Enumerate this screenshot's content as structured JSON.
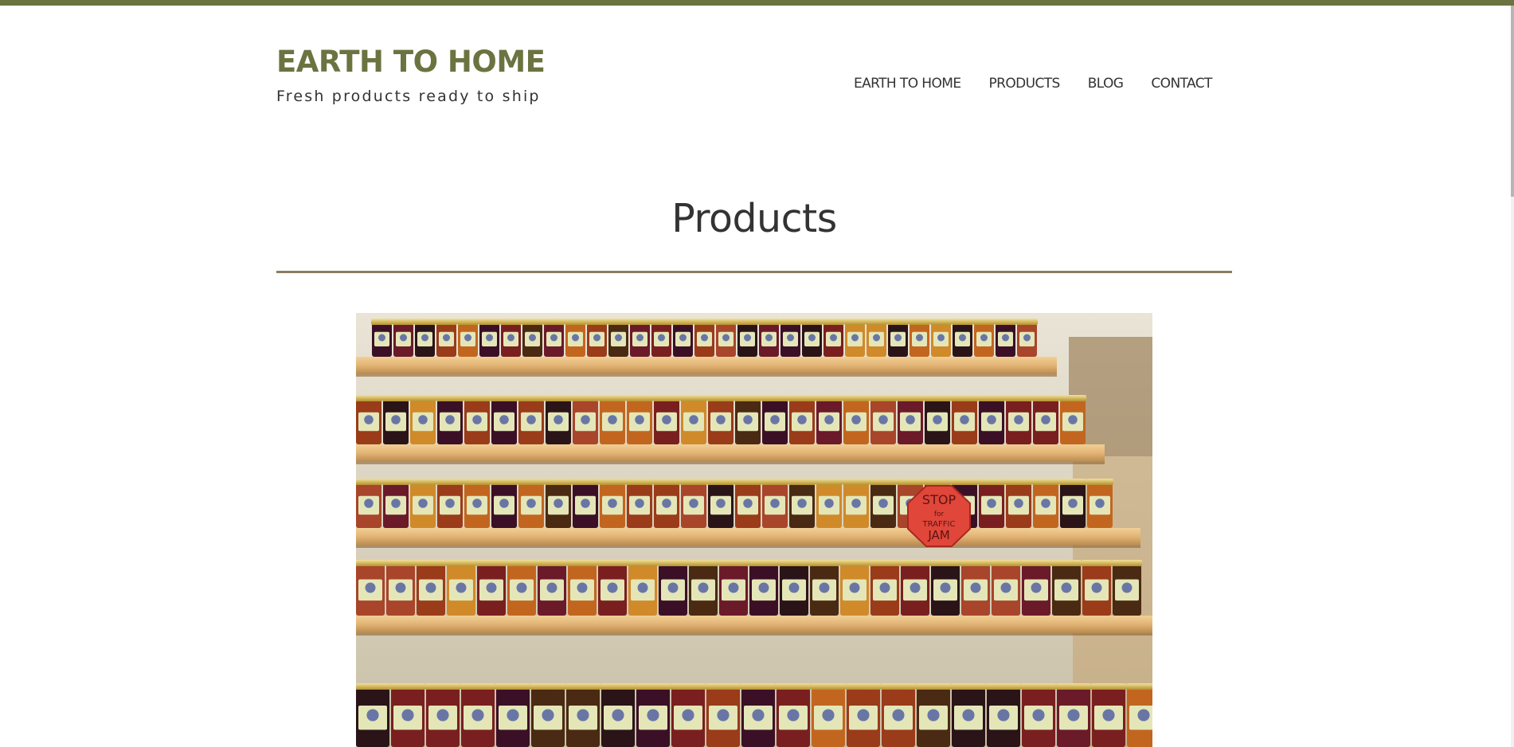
{
  "site": {
    "title": "EARTH TO HOME",
    "tagline": "Fresh products ready to ship"
  },
  "nav": {
    "items": [
      {
        "label": "EARTH TO HOME"
      },
      {
        "label": "PRODUCTS"
      },
      {
        "label": "BLOG"
      },
      {
        "label": "CONTACT"
      }
    ]
  },
  "page": {
    "heading": "Products"
  },
  "hero_image": {
    "sign_text": [
      "STOP",
      "for",
      "TRAFFIC",
      "JAM"
    ]
  },
  "colors": {
    "accent": "#6b7340",
    "divider": "#8b7d5e",
    "text": "#333333",
    "background": "#ffffff"
  }
}
